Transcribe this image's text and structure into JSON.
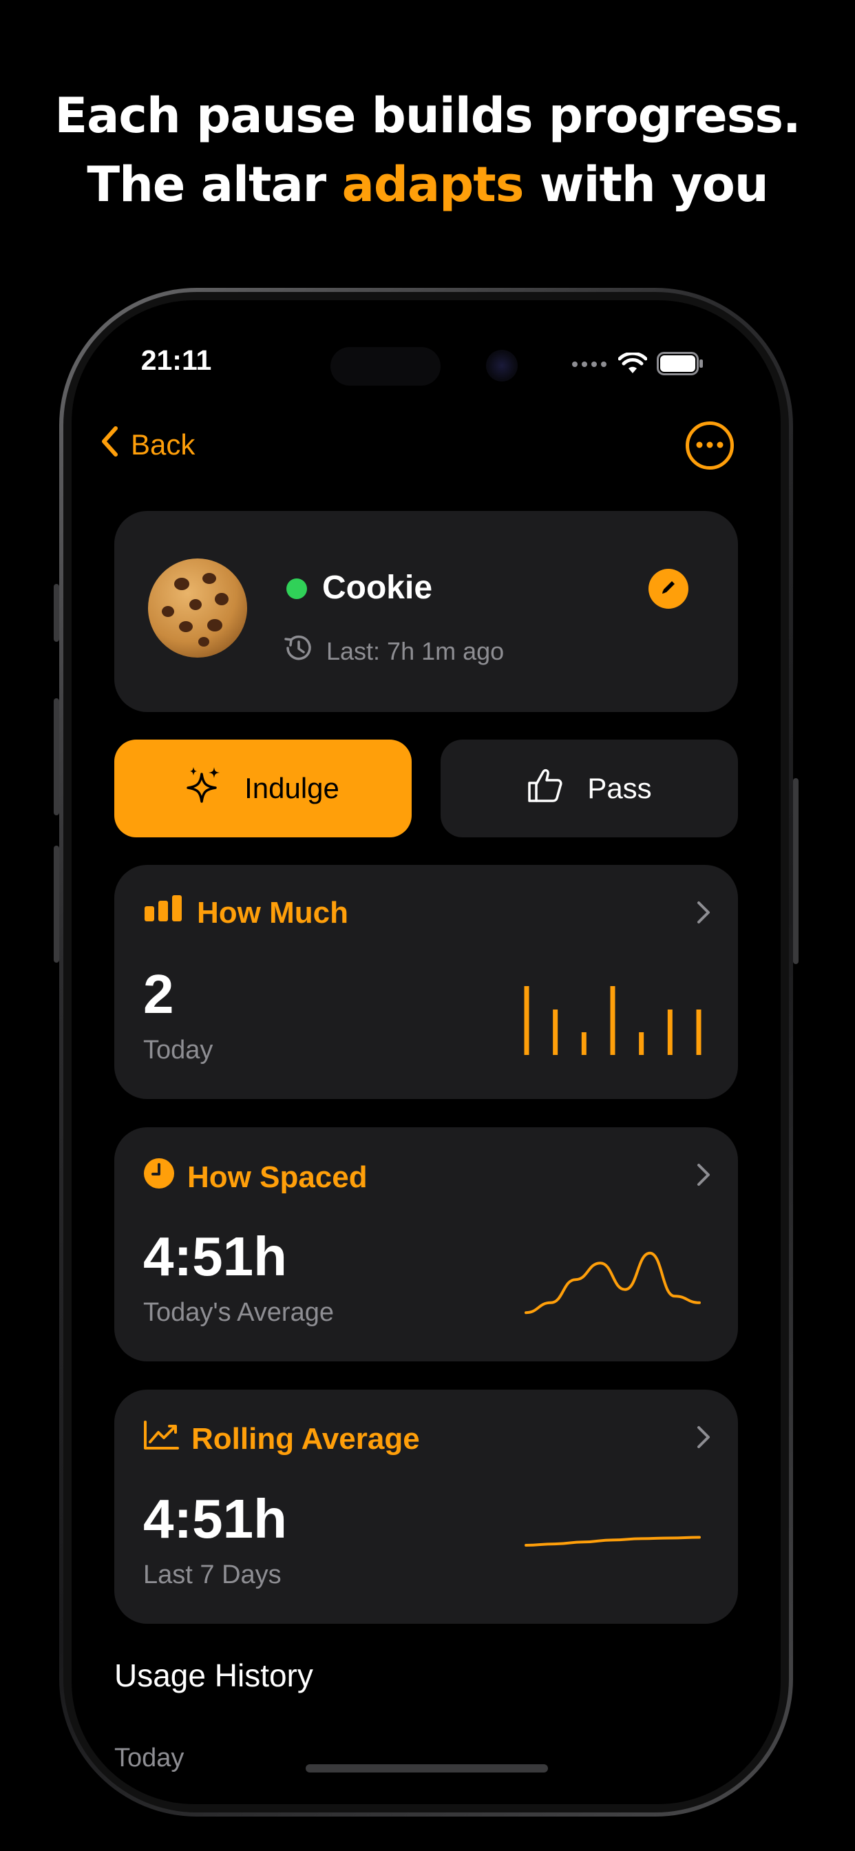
{
  "headline": {
    "line1": "Each pause builds progress.",
    "line2_before": "The altar ",
    "line2_accent": "adapts",
    "line2_after": " with you"
  },
  "status_bar": {
    "time": "21:11"
  },
  "nav": {
    "back_label": "Back"
  },
  "item": {
    "name": "Cookie",
    "status_color": "#30D158",
    "last_text": "Last: 7h 1m ago"
  },
  "actions": {
    "indulge_label": "Indulge",
    "pass_label": "Pass"
  },
  "metrics": [
    {
      "title": "How Much",
      "icon": "bar-chart-icon",
      "value": "2",
      "label": "Today",
      "chart": {
        "type": "bar",
        "values": [
          1.0,
          0.66,
          0.33,
          1.0,
          0.33,
          0.66,
          0.66
        ]
      }
    },
    {
      "title": "How Spaced",
      "icon": "clock-icon",
      "value": "4:51h",
      "label": "Today's Average",
      "chart": {
        "type": "line",
        "values": [
          0.05,
          0.2,
          0.55,
          0.8,
          0.4,
          0.95,
          0.3,
          0.2
        ]
      }
    },
    {
      "title": "Rolling Average",
      "icon": "trend-icon",
      "value": "4:51h",
      "label": "Last 7 Days",
      "chart": {
        "type": "line",
        "values": [
          0.5,
          0.52,
          0.55,
          0.58,
          0.6,
          0.61,
          0.62
        ]
      }
    }
  ],
  "history": {
    "title": "Usage History",
    "group_label": "Today"
  },
  "colors": {
    "accent": "#FF9F0A",
    "card": "#1c1c1e",
    "secondary_text": "#8E8E93"
  }
}
